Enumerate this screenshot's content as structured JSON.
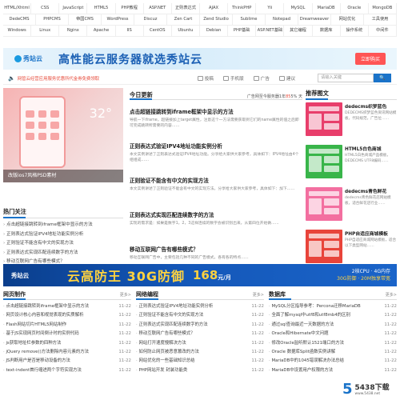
{
  "tag_rows": [
    [
      "HTML/Xhtml",
      "CSS",
      "JavaScript",
      "HTML5",
      "PHP教程",
      "ASP.NET",
      "正则表达式",
      "AJAX",
      "ThinkPHP",
      "Yii",
      "MySQL",
      "MariaDB",
      "Oracle",
      "MongoDB"
    ],
    [
      "DedeCMS",
      "PHPCMS",
      "帝国CMS",
      "WordPress",
      "Discuz",
      "Zen Cart",
      "Zend Studio",
      "Sublime",
      "Notepad",
      "Dreamweaver",
      "网站优化",
      "工具使用"
    ],
    [
      "Windows",
      "Linux",
      "Nginx",
      "Apache",
      "IIS",
      "CentOS",
      "Ubuntu",
      "Debian",
      "PHP基础",
      "ASP.NET基础",
      "其它编程",
      "数据库",
      "操作系统",
      "中间件"
    ]
  ],
  "banner": {
    "logo": "秀站云",
    "slogan": "高性能云服务器就选秀站云",
    "cta": "立即购买"
  },
  "notice": {
    "text": "网管云经营应用服务优惠所代金券免费领取",
    "tools": [
      "投稿",
      "手机版",
      "广告",
      "建议"
    ],
    "search_placeholder": "请输入关键",
    "search_button": "🔍"
  },
  "feature": {
    "temp": "32°",
    "caption": "改版ios7风格PSD素材"
  },
  "focus": {
    "title": "热门关注",
    "items": [
      "点击超链接跳转到iframe框架中显示的方法",
      "正则表达式验证IPV4地址功能实例分析",
      "正则验证不能含有中文的实现方法",
      "正则表达式实现匹配连续数字的方法",
      "移动互联网广告有哪些模式？"
    ]
  },
  "updates": {
    "title": "今日更新",
    "stat_prefix": "广告网至今服务器1年",
    "stat_days": "85",
    "stat_suffix": "5% 天",
    "articles": [
      {
        "title": "点击超链接跳转到iframe框架中显示的方法",
        "desc": "导航一下iframe，超链接加上target属性，注意这个一方法需要获取到它们的name属性的值之后即可完成跳转所需要的内容……"
      },
      {
        "title": "正则表达式验证IPV4地址功能实例分析",
        "desc": "本文实例讲述了正则表达式验证IPV4地址功能。分享给大家供大家参考，具体如下：IPV4地址由4个组组成……"
      },
      {
        "title": "正则验证不能含有中文的实现方法",
        "desc": "本文实例讲述了正则验证不能含有中文的实现方法。分享给大家供大家参考，具体如下：加下……"
      },
      {
        "title": "正则表达式实现匹配连续数字的方法",
        "desc": "实现的需求是：如果是数字1，2，3这样连续的数字会被识别出来，从第四位开始做……"
      },
      {
        "title": "移动互联网广告有哪些模式？",
        "desc": "移动互联网广告中，主要包括几种不同的广告模式，各有各的特点……"
      }
    ]
  },
  "recs": {
    "title": "推荐图文",
    "items": [
      {
        "title": "dedecms织梦蓝色",
        "desc": "DEDECMS织梦蓝色资讯网站模板，代码规范，广告位……",
        "color": "#e83e6b"
      },
      {
        "title": "HTML5白色商城",
        "desc": "HTML5白色商城产品模板，DEDECMS UTF8编码……",
        "color": "#39b54a"
      },
      {
        "title": "dedecms青色鲜花",
        "desc": "dedecms青色鲜花店网站模板，适合鲜花店行业……",
        "color": "#f36fa0"
      },
      {
        "title": "PHP自适应商城模板",
        "desc": "PHP自适应商城网站模板，适合以下类型网站……",
        "color": "#e8443a"
      }
    ]
  },
  "ad2": {
    "logo": "秀站云",
    "big": "云高防王 30G防御",
    "price": "168",
    "unit": "元/月",
    "side_top": "2核CPU · 4G内存",
    "side_bottom": "30G防御 · 20M独享带宽"
  },
  "columns": [
    {
      "title": "网页制作",
      "more": "更多>",
      "items": [
        {
          "text": "点击超链接跳转到iframe框架中显示的方法",
          "date": "11-22"
        },
        {
          "text": "网页设计核心内容和视觉表现的实质解析",
          "date": "11-22"
        },
        {
          "text": "Flash网站切片HTML5网站制作",
          "date": "11-22"
        },
        {
          "text": "基于JS实现网页时间倒计时的实例代码",
          "date": "11-22"
        },
        {
          "text": "js获取地址栏参数的四种方法",
          "date": "11-22"
        },
        {
          "text": "jQuery remove()方法删除内容元素的方法",
          "date": "11-22"
        },
        {
          "text": "JS判断用户是否是移动设备的方法",
          "date": "11-22"
        },
        {
          "text": "text-indent首行缩进两个字符实现方法",
          "date": "11-22"
        }
      ]
    },
    {
      "title": "网络编程",
      "more": "更多>",
      "items": [
        {
          "text": "正则表达式验证IPV4地址功能实例分析",
          "date": "11-22"
        },
        {
          "text": "正则验证不能含有中文的实现方法",
          "date": "11-22"
        },
        {
          "text": "正则表达式实现匹配连续数字的方法",
          "date": "11-22"
        },
        {
          "text": "移动互联网广告有哪些模式？",
          "date": "11-22"
        },
        {
          "text": "网站打开速度慢解决方法",
          "date": "11-22"
        },
        {
          "text": "如何防止网页被恶意篡改的方法",
          "date": "11-22"
        },
        {
          "text": "网站优化的一些基础知识总结",
          "date": "11-22"
        },
        {
          "text": "PHP网站开发 封装功能类",
          "date": "11-22"
        }
      ]
    },
    {
      "title": "数据库",
      "more": "更多>",
      "items": [
        {
          "text": "MySQL分区指导参考：Percona迁移MariaDB",
          "date": "11-22"
        },
        {
          "text": "全面了解mysql中utf8和utf8mb4的区别",
          "date": "11-22"
        },
        {
          "text": "通过sql查询最近一天数据的方法",
          "date": "11-22"
        },
        {
          "text": "Oracle和Hibernate中文问题",
          "date": "11-22"
        },
        {
          "text": "修改Oracle监听默认1521端口的方法",
          "date": "11-22"
        },
        {
          "text": "Oracle 数据库Split函数实例讲解",
          "date": "11-22"
        },
        {
          "text": "MariaDB中的1045错误解决办法总结",
          "date": "11-22"
        },
        {
          "text": "MariaDB中设置用户权限的方法",
          "date": "11-22"
        }
      ]
    }
  ],
  "watermark": {
    "num": "5",
    "line1": "5438下载",
    "line2": "www.5438.net"
  }
}
